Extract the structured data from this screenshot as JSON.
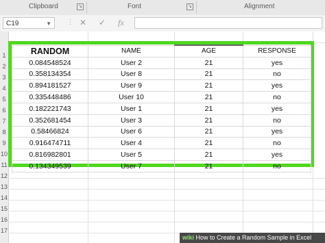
{
  "ribbon": {
    "groups": [
      {
        "label": "Clipboard"
      },
      {
        "label": "Font"
      },
      {
        "label": "Alignment"
      }
    ]
  },
  "formula_bar": {
    "name_box": "C19",
    "fx_label": "fx",
    "cancel_label": "✕",
    "enter_label": "✓"
  },
  "row_numbers": [
    "1",
    "2",
    "3",
    "4",
    "5",
    "6",
    "7",
    "8",
    "9",
    "10",
    "11",
    "12",
    "13",
    "14",
    "15",
    "16",
    "17"
  ],
  "table": {
    "headers": [
      "RANDOM",
      "NAME",
      "AGE",
      "RESPONSE"
    ],
    "rows": [
      [
        "0.084548524",
        "User 2",
        "21",
        "yes"
      ],
      [
        "0.358134354",
        "User 8",
        "21",
        "no"
      ],
      [
        "0.894181527",
        "User 9",
        "21",
        "yes"
      ],
      [
        "0.335448486",
        "User 10",
        "21",
        "no"
      ],
      [
        "0.182221743",
        "User 1",
        "21",
        "yes"
      ],
      [
        "0.352681454",
        "User 3",
        "21",
        "no"
      ],
      [
        "0.58466824",
        "User 6",
        "21",
        "yes"
      ],
      [
        "0.916474711",
        "User 4",
        "21",
        "no"
      ],
      [
        "0.816982801",
        "User 5",
        "21",
        "yes"
      ],
      [
        "0.134349539",
        "User 7",
        "21",
        "no"
      ]
    ]
  },
  "highlight_color": "#4fd81f",
  "watermark": {
    "brand": "wiki",
    "text": "How to Create a Random Sample in Excel"
  }
}
